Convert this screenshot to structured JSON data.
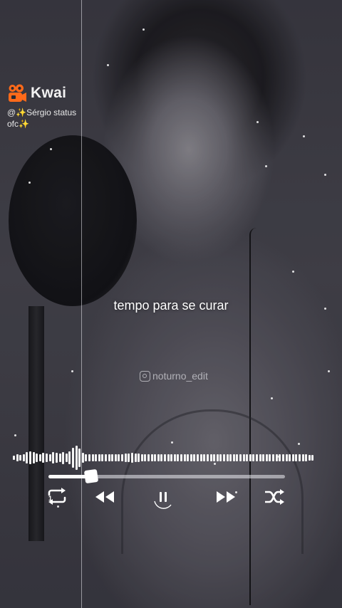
{
  "brand": {
    "name": "Kwai",
    "handle_line1": "@✨Sérgio status",
    "handle_line2": "ofc✨"
  },
  "lyric": "tempo para se curar",
  "watermark": "noturno_edit",
  "player": {
    "progress": 0.18,
    "controls": [
      "repeat-one-icon",
      "previous-icon",
      "pause-icon",
      "next-icon",
      "shuffle-icon"
    ],
    "visualizer_levels": [
      0.2,
      0.3,
      0.25,
      0.3,
      0.45,
      0.55,
      0.45,
      0.35,
      0.3,
      0.4,
      0.35,
      0.3,
      0.45,
      0.4,
      0.35,
      0.5,
      0.35,
      0.55,
      0.85,
      1.0,
      0.75,
      0.4,
      0.3,
      0.28,
      0.3,
      0.32,
      0.28,
      0.3,
      0.3,
      0.28,
      0.3,
      0.32,
      0.3,
      0.28,
      0.35,
      0.38,
      0.4,
      0.38,
      0.35,
      0.3,
      0.32,
      0.3,
      0.28,
      0.3,
      0.3,
      0.32,
      0.3,
      0.28,
      0.3,
      0.3,
      0.28,
      0.3,
      0.3,
      0.32,
      0.3,
      0.3,
      0.28,
      0.3,
      0.3,
      0.32,
      0.3,
      0.28,
      0.3,
      0.3,
      0.32,
      0.3,
      0.28,
      0.3,
      0.3,
      0.32,
      0.3,
      0.28,
      0.3,
      0.32,
      0.3,
      0.3,
      0.28,
      0.3,
      0.3,
      0.32,
      0.3,
      0.28,
      0.3,
      0.3,
      0.32,
      0.3,
      0.3,
      0.32,
      0.3,
      0.28,
      0.25,
      0.22
    ],
    "accent_color": "#ffffff",
    "brand_color": "#ff6a1a"
  }
}
